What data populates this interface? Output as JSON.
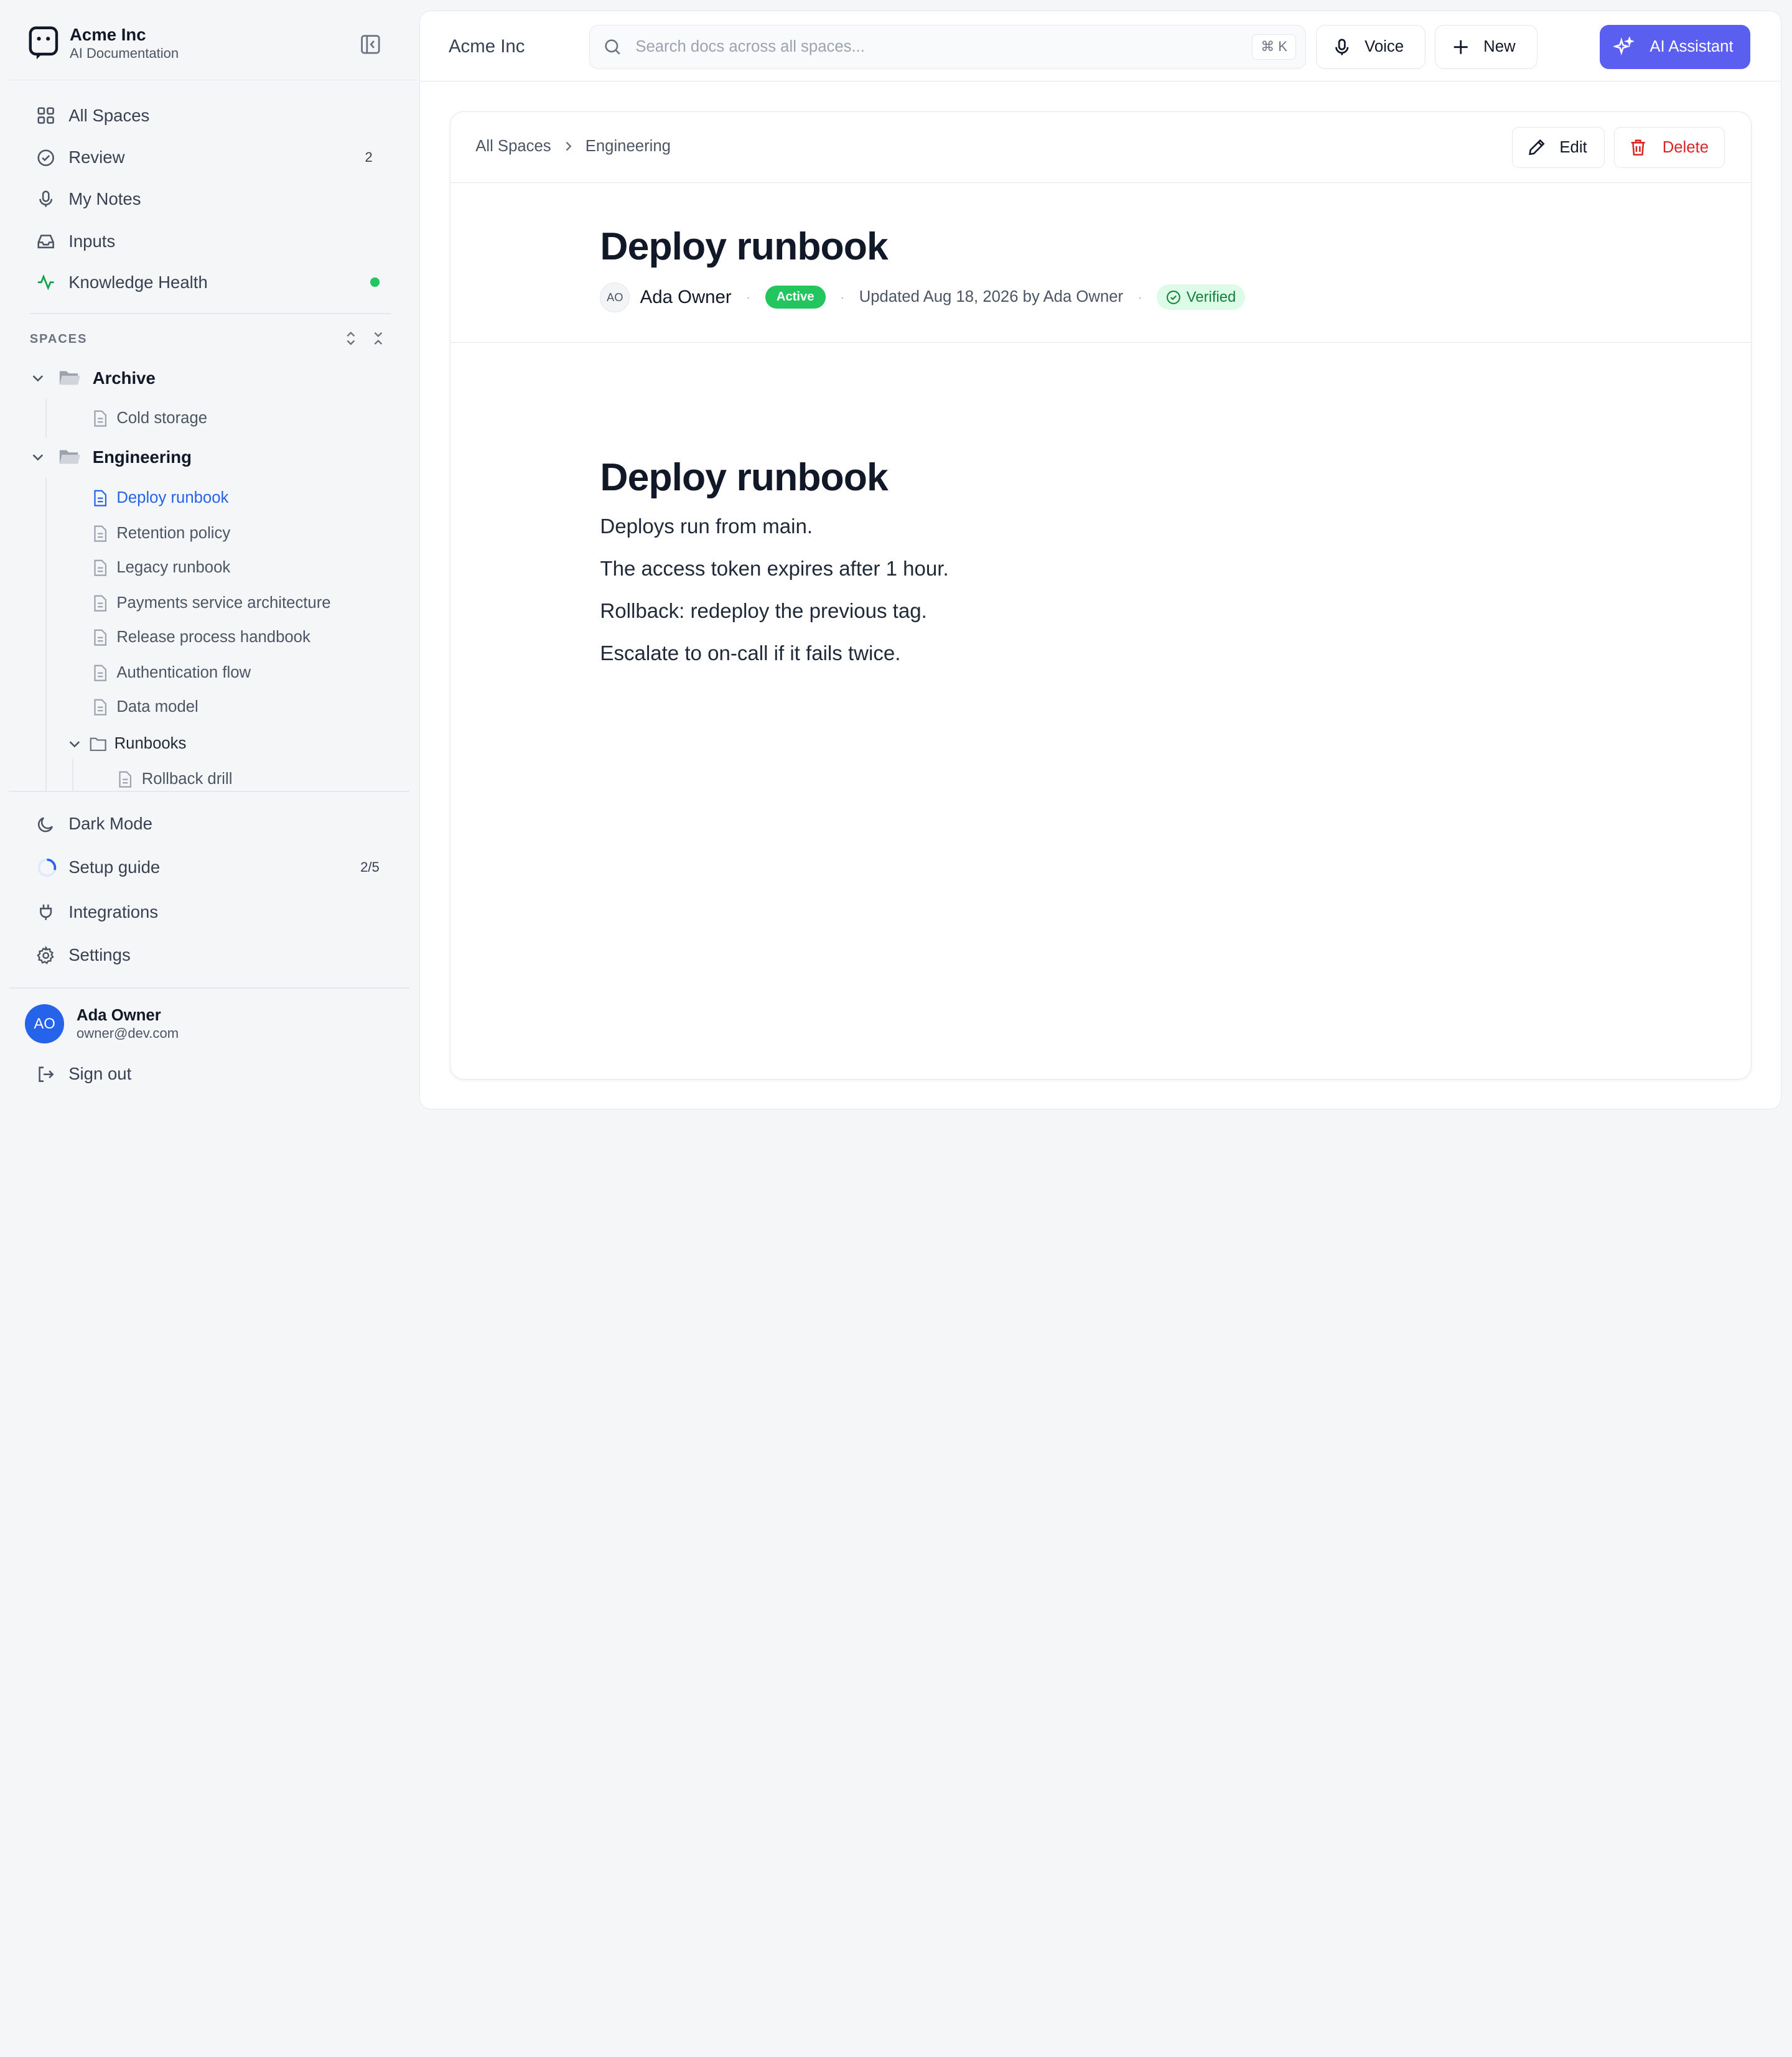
{
  "brand": {
    "name": "Acme Inc",
    "subtitle": "AI Documentation"
  },
  "nav": [
    {
      "label": "All Spaces",
      "icon": "grid-icon"
    },
    {
      "label": "Review",
      "icon": "check-circle-icon",
      "count": "2"
    },
    {
      "label": "My Notes",
      "icon": "mic-icon"
    },
    {
      "label": "Inputs",
      "icon": "inbox-icon"
    },
    {
      "label": "Knowledge Health",
      "icon": "activity-icon",
      "status_color": "#22c55e"
    }
  ],
  "spaces": {
    "heading": "SPACES",
    "tree": [
      {
        "label": "Archive",
        "type": "folder",
        "children": [
          "Cold storage"
        ]
      },
      {
        "label": "Engineering",
        "type": "folder",
        "children": [
          "Deploy runbook",
          "Retention policy",
          "Legacy runbook",
          "Payments service architecture",
          "Release process handbook",
          "Authentication flow",
          "Data model"
        ]
      },
      {
        "label": "Runbooks",
        "type": "subfolder",
        "children": [
          "Rollback drill"
        ]
      }
    ],
    "active_doc": "Deploy runbook"
  },
  "bottom_nav": [
    {
      "label": "Dark Mode",
      "icon": "moon-icon"
    },
    {
      "label": "Setup guide",
      "icon": "progress-ring-icon",
      "count": "2/5"
    },
    {
      "label": "Integrations",
      "icon": "plug-icon"
    },
    {
      "label": "Settings",
      "icon": "gear-icon"
    }
  ],
  "user": {
    "initials": "AO",
    "name": "Ada Owner",
    "email": "owner@dev.com",
    "signout_label": "Sign out"
  },
  "topbar": {
    "workspace": "Acme Inc",
    "search_placeholder": "Search docs across all spaces...",
    "search_shortcut": "⌘ K",
    "voice_label": "Voice",
    "new_label": "New",
    "ai_label": "AI Assistant",
    "ai_color": "#5b5ff0"
  },
  "breadcrumbs": [
    "All Spaces",
    "Engineering"
  ],
  "actions": {
    "edit_label": "Edit",
    "delete_label": "Delete"
  },
  "doc": {
    "title": "Deploy runbook",
    "author_initials": "AO",
    "author": "Ada Owner",
    "status": "Active",
    "status_color": "#22c55e",
    "updated": "Updated Aug 18, 2026 by Ada Owner",
    "verified": "Verified",
    "body_heading": "Deploy runbook",
    "body": [
      "Deploys run from main.",
      "The access token expires after 1 hour.",
      "Rollback: redeploy the previous tag.",
      "Escalate to on-call if it fails twice."
    ]
  }
}
